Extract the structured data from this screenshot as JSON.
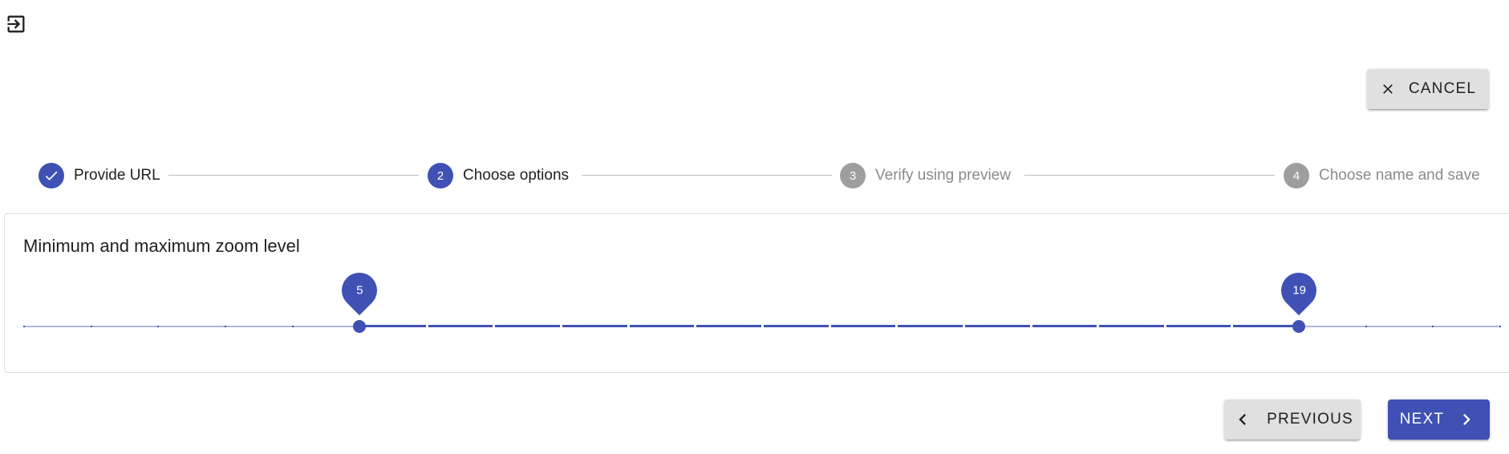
{
  "header": {
    "exit_icon": "exit-to-app-icon"
  },
  "toolbar": {
    "cancel_label": "CANCEL",
    "cancel_icon": "close-icon"
  },
  "stepper": {
    "steps": [
      {
        "number": "1",
        "label": "Provide URL",
        "state": "completed",
        "icon": "check-icon"
      },
      {
        "number": "2",
        "label": "Choose options",
        "state": "active"
      },
      {
        "number": "3",
        "label": "Verify using preview",
        "state": "pending"
      },
      {
        "number": "4",
        "label": "Choose name and save",
        "state": "pending"
      }
    ]
  },
  "options": {
    "zoom_title": "Minimum and maximum zoom level",
    "zoom_slider": {
      "min": 0,
      "max": 22,
      "step": 1,
      "low": 5,
      "high": 19,
      "low_label": "5",
      "high_label": "19"
    }
  },
  "navigation": {
    "previous_label": "PREVIOUS",
    "previous_icon": "chevron-left-icon",
    "next_label": "NEXT",
    "next_icon": "chevron-right-icon"
  },
  "colors": {
    "primary": "#3f51b5",
    "inactive_step": "#9e9e9e",
    "button_grey": "#e0e0e0",
    "rail": "#b0b6df"
  }
}
